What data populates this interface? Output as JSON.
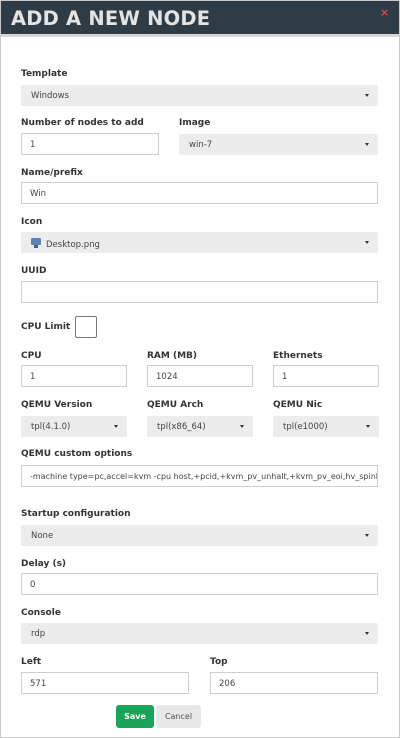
{
  "dialog": {
    "title": "ADD A NEW NODE",
    "close_glyph": "×"
  },
  "template": {
    "label": "Template",
    "value": "Windows"
  },
  "num_nodes": {
    "label": "Number of nodes to add",
    "value": "1"
  },
  "image": {
    "label": "Image",
    "value": "win-7"
  },
  "name_prefix": {
    "label": "Name/prefix",
    "value": "Win"
  },
  "icon": {
    "label": "Icon",
    "value": "Desktop.png",
    "icon_name": "desktop-monitor-icon"
  },
  "uuid": {
    "label": "UUID",
    "value": ""
  },
  "cpu_limit": {
    "label": "CPU Limit",
    "checked": false
  },
  "cpu": {
    "label": "CPU",
    "value": "1"
  },
  "ram": {
    "label": "RAM (MB)",
    "value": "1024"
  },
  "ethernets": {
    "label": "Ethernets",
    "value": "1"
  },
  "qemu_version": {
    "label": "QEMU Version",
    "value": "tpl(4.1.0)"
  },
  "qemu_arch": {
    "label": "QEMU Arch",
    "value": "tpl(x86_64)"
  },
  "qemu_nic": {
    "label": "QEMU Nic",
    "value": "tpl(e1000)"
  },
  "qemu_options": {
    "label": "QEMU custom options",
    "value": "-machine type=pc,accel=kvm -cpu host,+pcid,+kvm_pv_unhalt,+kvm_pv_eoi,hv_spinlocks=0x1fff,hv_vapic,hv_time,hv_reset,hv_vpindex,hv_runtime,hv_relaxed,hv_synic,hv_stimer -vga std -usbdevice tablet"
  },
  "startup_config": {
    "label": "Startup configuration",
    "value": "None"
  },
  "delay": {
    "label": "Delay (s)",
    "value": "0"
  },
  "console": {
    "label": "Console",
    "value": "rdp"
  },
  "left": {
    "label": "Left",
    "value": "571"
  },
  "top": {
    "label": "Top",
    "value": "206"
  },
  "buttons": {
    "save": "Save",
    "cancel": "Cancel"
  },
  "colors": {
    "header_bg": "#2f3b45",
    "save_green": "#1aa45a",
    "close_red": "#e0464a"
  }
}
